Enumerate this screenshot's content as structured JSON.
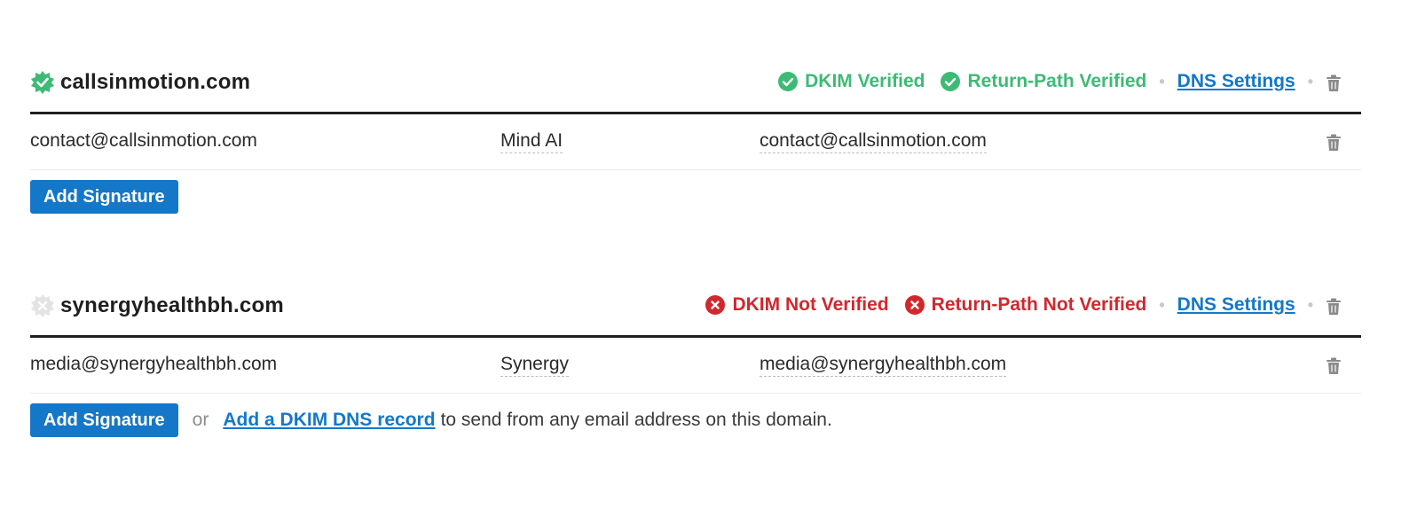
{
  "domains": [
    {
      "name": "callsinmotion.com",
      "verified": true,
      "dkim_status": "DKIM Verified",
      "return_path_status": "Return-Path Verified",
      "dns_settings_label": "DNS Settings",
      "signatures": [
        {
          "email": "contact@callsinmotion.com",
          "name": "Mind AI",
          "from": "contact@callsinmotion.com"
        }
      ],
      "add_signature_label": "Add Signature"
    },
    {
      "name": "synergyhealthbh.com",
      "verified": false,
      "dkim_status": "DKIM Not Verified",
      "return_path_status": "Return-Path Not Verified",
      "dns_settings_label": "DNS Settings",
      "signatures": [
        {
          "email": "media@synergyhealthbh.com",
          "name": "Synergy",
          "from": "media@synergyhealthbh.com"
        }
      ],
      "add_signature_label": "Add Signature",
      "or_text": "or",
      "dkim_link_label": "Add a DKIM DNS record",
      "dkim_hint": "to send from any email address on this domain."
    }
  ],
  "colors": {
    "verified": "#3dbb75",
    "not_verified": "#d0282e",
    "link": "#1478c8",
    "button": "#1477c7"
  },
  "icons": {
    "verified_badge": "verified-badge-icon",
    "unverified_badge": "unverified-badge-icon",
    "check": "check-circle-icon",
    "error": "x-circle-icon",
    "trash": "trash-icon"
  }
}
